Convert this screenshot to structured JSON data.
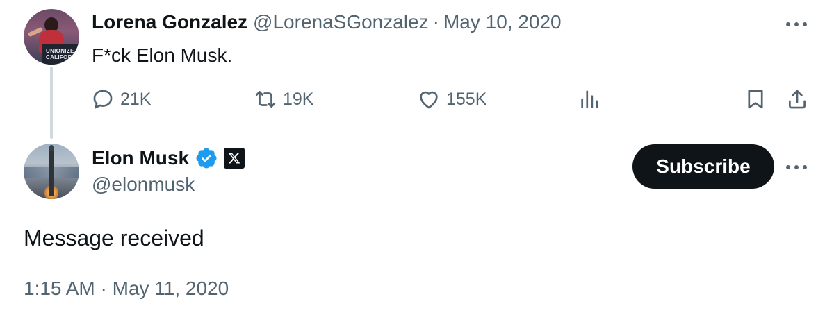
{
  "reply_to_tweet": {
    "author_name": "Lorena Gonzalez",
    "handle": "@LorenaSGonzalez",
    "separator": "·",
    "date": "May 10, 2020",
    "avatar_text": "UNIONIZE CALIFORNIA",
    "text": "F*ck Elon Musk.",
    "actions": {
      "replies": "21K",
      "retweets": "19K",
      "likes": "155K"
    },
    "icons": [
      "reply-icon",
      "retweet-icon",
      "like-icon",
      "views-icon",
      "bookmark-icon",
      "share-icon",
      "more-icon"
    ]
  },
  "main_tweet": {
    "author_name": "Elon Musk",
    "handle": "@elonmusk",
    "subscribe_label": "Subscribe",
    "text": "Message received",
    "timestamp": "1:15 AM · May 11, 2020",
    "icons": [
      "verified-badge-icon",
      "x-affiliate-badge-icon",
      "more-icon"
    ]
  },
  "colors": {
    "text_primary": "#0f1419",
    "text_muted": "#536471",
    "verified_blue": "#1d9bf0",
    "thread_line": "#cfd9de",
    "button_bg": "#0f1419"
  }
}
